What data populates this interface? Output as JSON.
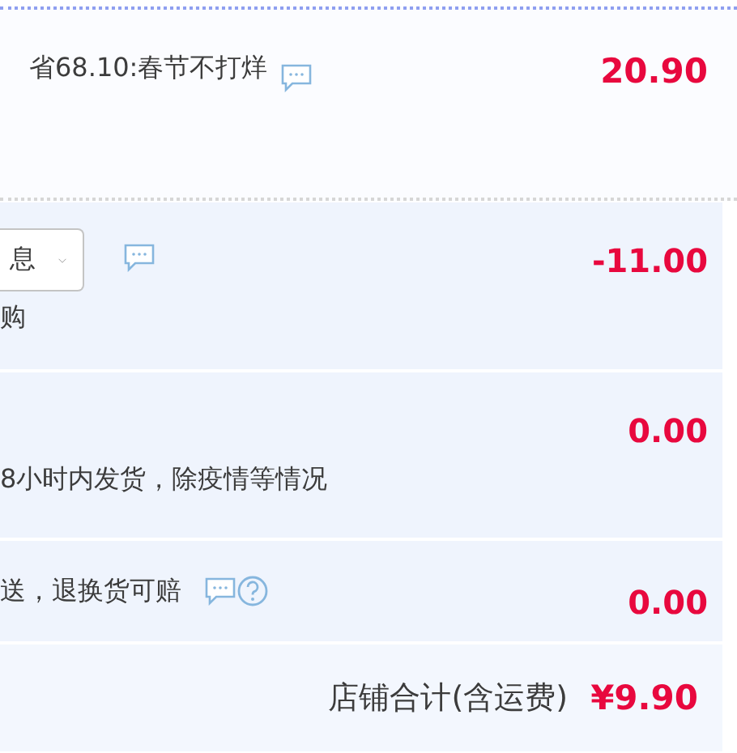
{
  "promo": {
    "text": "省68.10:春节不打烊",
    "amount": "20.90"
  },
  "rows": [
    {
      "kind": "select",
      "value": "息",
      "note": "购",
      "amount": "-11.00"
    },
    {
      "kind": "text",
      "line": "8小时内发货，除疫情等情况",
      "amount": "0.00"
    },
    {
      "kind": "service",
      "text": "送，退换货可赔",
      "amount": "0.00"
    }
  ],
  "total": {
    "label": "店铺合计(含运费)",
    "amount": "¥9.90"
  }
}
